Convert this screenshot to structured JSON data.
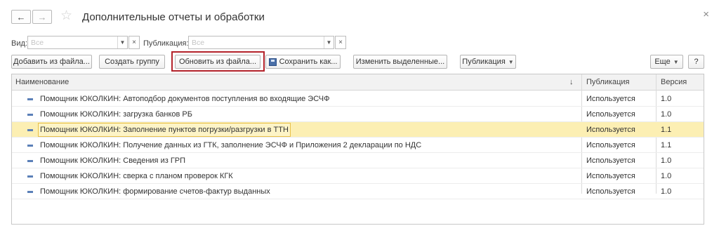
{
  "window": {
    "title": "Дополнительные отчеты и обработки",
    "back_icon": "←",
    "forward_icon": "→",
    "favorite_icon": "☆",
    "close_icon": "×"
  },
  "filters": {
    "view_label": "Вид:",
    "view_placeholder": "Все",
    "publication_label": "Публикация:",
    "publication_placeholder": "Все"
  },
  "toolbar": {
    "add_from_file": "Добавить из файла...",
    "create_group": "Создать группу",
    "update_from_file": "Обновить из файла...",
    "save_as": "Сохранить как...",
    "change_selected": "Изменить выделенные...",
    "publication": "Публикация",
    "more": "Еще",
    "help": "?"
  },
  "table": {
    "columns": [
      "Наименование",
      "Публикация",
      "Версия"
    ],
    "sort_indicator": "↓",
    "rows": [
      {
        "name": "Помощник ЮКОЛКИН: Автоподбор документов поступления во входящие ЭСЧФ",
        "publication": "Используется",
        "version": "1.0",
        "selected": false
      },
      {
        "name": "Помощник ЮКОЛКИН: загрузка банков РБ",
        "publication": "Используется",
        "version": "1.0",
        "selected": false
      },
      {
        "name": "Помощник ЮКОЛКИН: Заполнение пунктов погрузки/разгрузки в ТТН",
        "publication": "Используется",
        "version": "1.1",
        "selected": true
      },
      {
        "name": "Помощник ЮКОЛКИН: Получение данных из ГТК, заполнение ЭСЧФ и Приложения 2 декларации по НДС",
        "publication": "Используется",
        "version": "1.1",
        "selected": false
      },
      {
        "name": "Помощник ЮКОЛКИН: Сведения из ГРП",
        "publication": "Используется",
        "version": "1.0",
        "selected": false
      },
      {
        "name": "Помощник ЮКОЛКИН: сверка с планом проверок КГК",
        "publication": "Используется",
        "version": "1.0",
        "selected": false
      },
      {
        "name": "Помощник ЮКОЛКИН: формирование счетов-фактур выданных",
        "publication": "Используется",
        "version": "1.0",
        "selected": false
      }
    ]
  }
}
